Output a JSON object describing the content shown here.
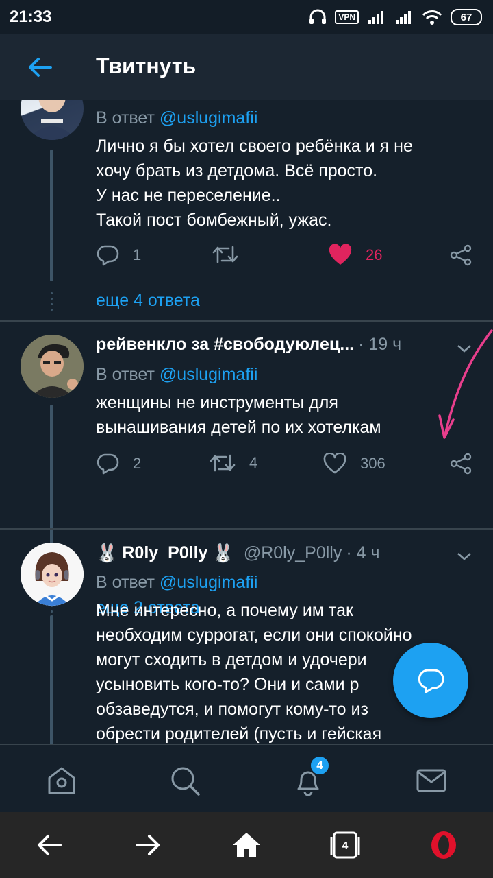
{
  "status_bar": {
    "time": "21:33",
    "vpn": "VPN",
    "battery": "67"
  },
  "header": {
    "title": "Твитнуть"
  },
  "tweets": [
    {
      "reply_prefix": "В ответ",
      "reply_handle": "@uslugimafii",
      "lines": [
        "Лично я бы хотел своего ребёнка и я не",
        "хочу брать из детдома. Всё просто.",
        "У нас не переселение..",
        "Такой пост бомбежный, ужас."
      ],
      "replies": "1",
      "likes": "26",
      "more": "еще 4 ответа"
    },
    {
      "name": "рейвенкло за #свободуюлец...",
      "meta": "· 19 ч",
      "reply_prefix": "В ответ",
      "reply_handle": "@uslugimafii",
      "lines": [
        "женщины не инструменты для",
        "вынашивания детей по их хотелкам"
      ],
      "replies": "2",
      "retweets": "4",
      "likes": "306",
      "more": "еще 2 ответа"
    },
    {
      "name": "R0ly_P0lly",
      "handle": "@R0ly_P0lly",
      "meta": "· 4 ч",
      "reply_prefix": "В ответ",
      "reply_handle": "@uslugimafii",
      "lines": [
        "Мне интересно, а почему им так",
        "необходим суррогат, если они спокойно",
        "могут сходить в детдом и удочери",
        "усыновить кого-то? Они и сами р",
        "обзаведутся, и помогут кому-то из",
        "обрести родителей (пусть и гейская"
      ]
    }
  ],
  "bottom_nav": {
    "notifications_badge": "4"
  },
  "system_nav": {
    "tabs_count": "4"
  },
  "colors": {
    "accent": "#1da1f2",
    "like": "#e0245e",
    "annotation": "#e83e8c",
    "background": "#15202b"
  }
}
